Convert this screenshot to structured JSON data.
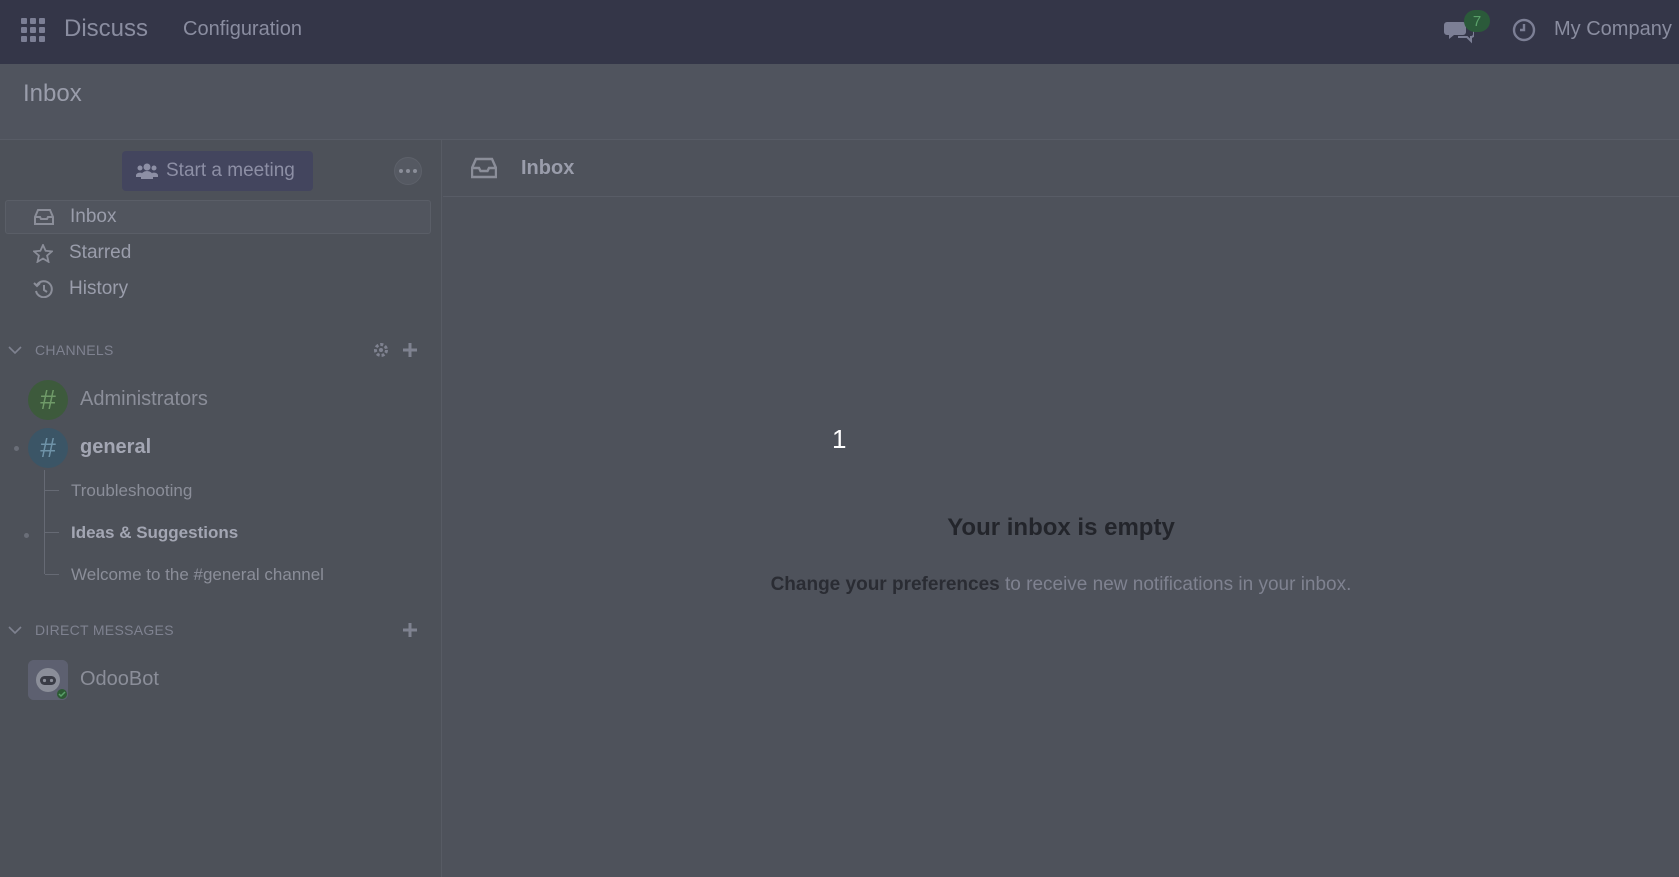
{
  "navbar": {
    "brand": "Discuss",
    "menu_config": "Configuration",
    "chat_count": "7",
    "company": "My Company"
  },
  "control_panel": {
    "title": "Inbox"
  },
  "sidebar": {
    "meeting_button": "Start a meeting",
    "mailboxes": [
      {
        "label": "Inbox",
        "icon": "inbox-icon",
        "active": true
      },
      {
        "label": "Starred",
        "icon": "star-icon"
      },
      {
        "label": "History",
        "icon": "history-icon"
      }
    ],
    "channels_header": "CHANNELS",
    "channels": [
      {
        "name": "Administrators"
      },
      {
        "name": "general"
      }
    ],
    "threads": [
      {
        "name": "Troubleshooting"
      },
      {
        "name": "Ideas & Suggestions"
      },
      {
        "name": "Welcome to the #general channel"
      }
    ],
    "dm_header": "DIRECT MESSAGES",
    "direct_messages": [
      {
        "name": "OdooBot"
      }
    ]
  },
  "main": {
    "header_title": "Inbox",
    "step_marker": "1",
    "empty_title": "Your inbox is empty",
    "empty_link": "Change your preferences",
    "empty_rest": " to receive new notifications in your inbox."
  },
  "colors": {
    "navbar_bg": "#343648",
    "overlay_bg": "#4e525b",
    "accent": "#43455e"
  }
}
